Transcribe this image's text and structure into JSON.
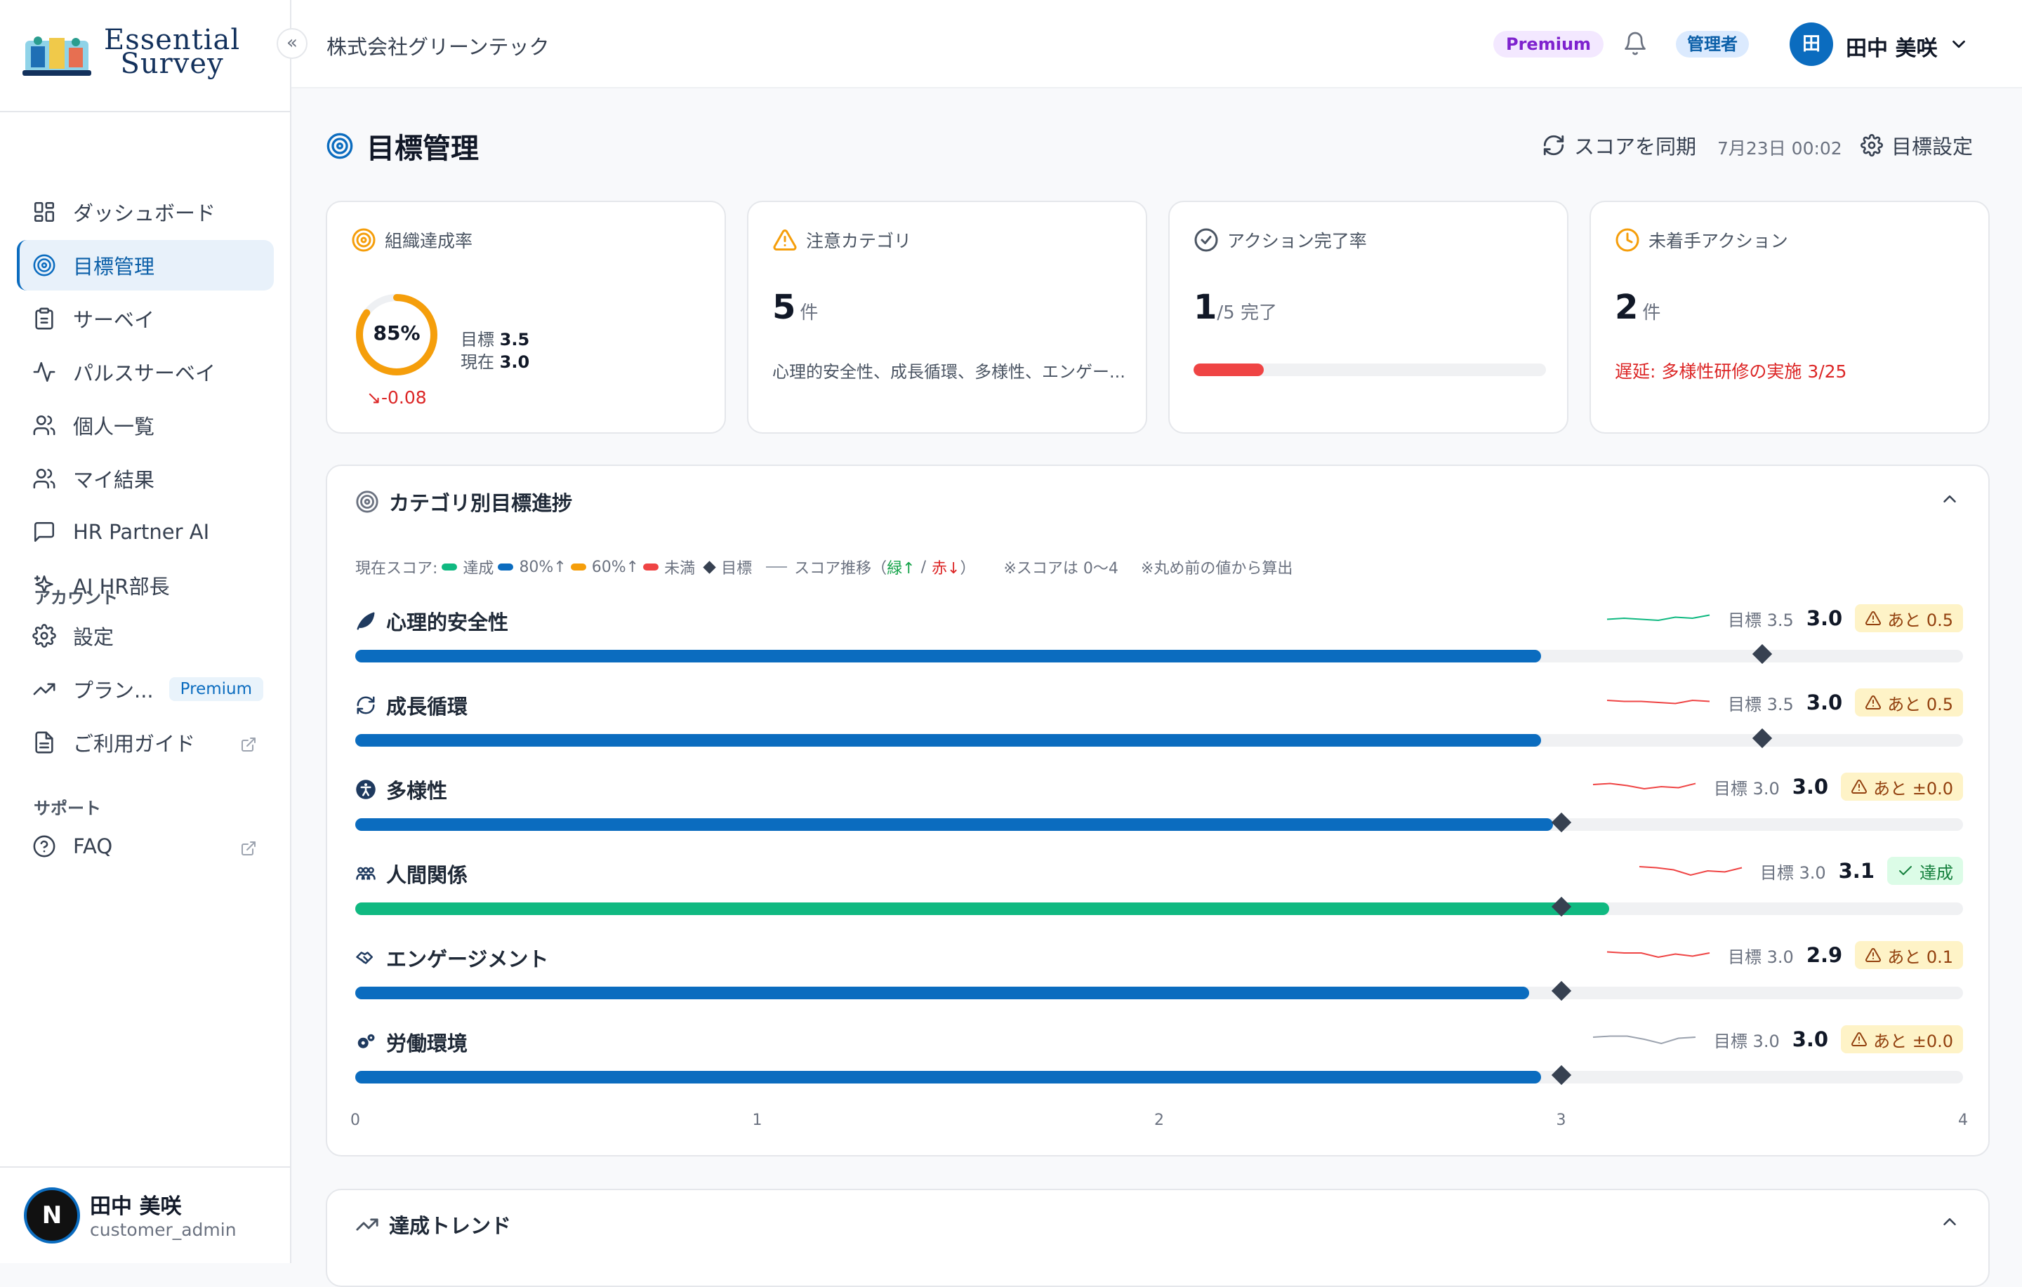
{
  "brand": {
    "line1": "Essential",
    "line2": "Survey"
  },
  "sidebar": {
    "collapse_icon": "chevrons-left-icon",
    "items": [
      {
        "label": "ダッシュボード",
        "icon": "dashboard-icon"
      },
      {
        "label": "目標管理",
        "icon": "target-icon",
        "active": true
      },
      {
        "label": "サーベイ",
        "icon": "clipboard-icon"
      },
      {
        "label": "パルスサーベイ",
        "icon": "pulse-icon"
      },
      {
        "label": "個人一覧",
        "icon": "users-icon"
      },
      {
        "label": "マイ結果",
        "icon": "users-icon"
      },
      {
        "label": "HR Partner AI",
        "icon": "chat-icon"
      },
      {
        "label": "AI HR部長",
        "icon": "sparkles-icon"
      }
    ],
    "account_section": "アカウント",
    "account_items": [
      {
        "label": "設定",
        "icon": "gear-icon"
      },
      {
        "label": "プラン...",
        "icon": "trending-up-icon",
        "badge": "Premium"
      },
      {
        "label": "ご利用ガイド",
        "icon": "document-icon",
        "external": true
      }
    ],
    "support_section": "サポート",
    "support_items": [
      {
        "label": "FAQ",
        "icon": "help-circle-icon",
        "external": true
      }
    ],
    "user": {
      "avatar": "N",
      "name": "田中 美咲",
      "role": "customer_admin"
    }
  },
  "header": {
    "company": "株式会社グリーンテック",
    "plan_badge": "Premium",
    "role_badge": "管理者",
    "avatar": "田",
    "user_name": "田中 美咲"
  },
  "page": {
    "title": "目標管理",
    "sync_label": "スコアを同期",
    "sync_time": "7月23日 00:02",
    "settings_label": "目標設定"
  },
  "stats": {
    "achievement": {
      "title": "組織達成率",
      "percent": "85%",
      "percent_value": 0.85,
      "target_label": "目標",
      "target": "3.5",
      "current_label": "現在",
      "current": "3.0",
      "delta": "-0.08"
    },
    "attention": {
      "title": "注意カテゴリ",
      "count": "5",
      "unit": "件",
      "sub": "心理的安全性、成長循環、多様性、エンゲー..."
    },
    "action_rate": {
      "title": "アクション完了率",
      "done": "1",
      "total": "/5 完了",
      "fraction": 0.2
    },
    "pending": {
      "title": "未着手アクション",
      "count": "2",
      "unit": "件",
      "delay": "遅延: 多様性研修の実施 3/25"
    }
  },
  "categories": {
    "title": "カテゴリ別目標進捗",
    "legend": {
      "prefix": "現在スコア:",
      "achieved": "達成",
      "p80": "80%↑",
      "p60": "60%↑",
      "below": "未満",
      "target": "目標",
      "trend_prefix": "スコア推移（",
      "green": "緑↑",
      "slash": "/",
      "red": "赤↓",
      "trend_suffix": "）",
      "scale_note": "※スコアは 0〜4",
      "round_note": "※丸め前の値から算出"
    },
    "colors": {
      "achieved": "#10b981",
      "p80": "#0b6cbf",
      "p60": "#f59e0b",
      "below": "#ef4444",
      "track": "#f0f1f3"
    },
    "axis": [
      "0",
      "1",
      "2",
      "3",
      "4"
    ],
    "rows": [
      {
        "name": "心理的安全性",
        "icon": "leaf-icon",
        "score": 2.95,
        "target": 3.5,
        "target_label": "目標 3.5",
        "current": "3.0",
        "badge": "あと 0.5",
        "status": "warn",
        "trend": "up",
        "spark": [
          0.55,
          0.5,
          0.55,
          0.6,
          0.45,
          0.5,
          0.35
        ]
      },
      {
        "name": "成長循環",
        "icon": "refresh-icon",
        "score": 2.95,
        "target": 3.5,
        "target_label": "目標 3.5",
        "current": "3.0",
        "badge": "あと 0.5",
        "status": "warn",
        "trend": "down",
        "spark": [
          0.4,
          0.45,
          0.45,
          0.5,
          0.55,
          0.4,
          0.45
        ]
      },
      {
        "name": "多様性",
        "icon": "accessibility-icon",
        "score": 2.98,
        "target": 3.0,
        "target_label": "目標 3.0",
        "current": "3.0",
        "badge": "あと ±0.0",
        "status": "warn",
        "trend": "down",
        "spark": [
          0.4,
          0.35,
          0.45,
          0.6,
          0.5,
          0.55,
          0.35
        ]
      },
      {
        "name": "人間関係",
        "icon": "people-icon",
        "score": 3.12,
        "target": 3.0,
        "target_label": "目標 3.0",
        "current": "3.1",
        "badge": "達成",
        "status": "ok",
        "trend": "down",
        "spark": [
          0.3,
          0.35,
          0.45,
          0.7,
          0.5,
          0.55,
          0.35
        ]
      },
      {
        "name": "エンゲージメント",
        "icon": "handshake-icon",
        "score": 2.92,
        "target": 3.0,
        "target_label": "目標 3.0",
        "current": "2.9",
        "badge": "あと 0.1",
        "status": "warn",
        "trend": "down",
        "spark": [
          0.35,
          0.4,
          0.4,
          0.6,
          0.45,
          0.55,
          0.4
        ]
      },
      {
        "name": "労働環境",
        "icon": "gears-icon",
        "score": 2.95,
        "target": 3.0,
        "target_label": "目標 3.0",
        "current": "3.0",
        "badge": "あと ±0.0",
        "status": "warn",
        "trend": "flat",
        "spark": [
          0.4,
          0.35,
          0.35,
          0.5,
          0.7,
          0.45,
          0.4
        ]
      }
    ]
  },
  "trend": {
    "title": "達成トレンド"
  }
}
